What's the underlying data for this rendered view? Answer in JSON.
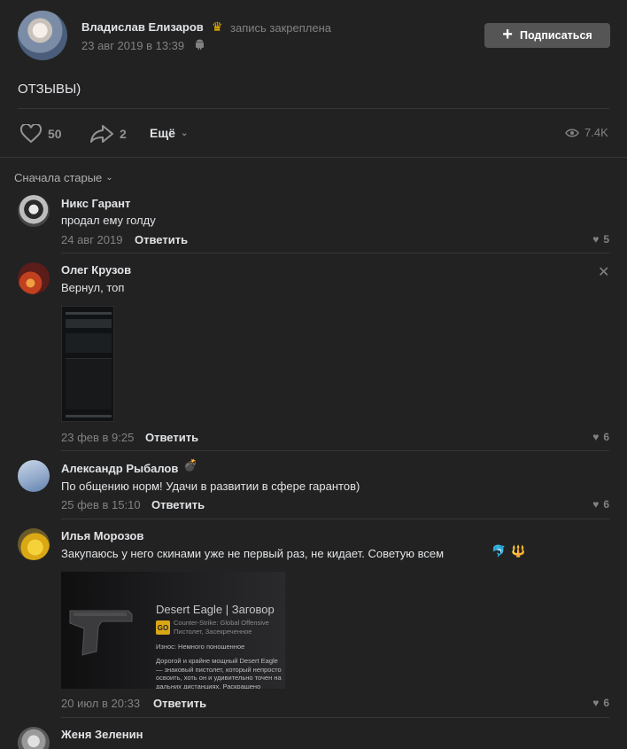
{
  "post": {
    "author": "Владислав Елизаров",
    "pinned_label": "запись закреплена",
    "date": "23 авг 2019 в 13:39",
    "subscribe_label": "Подписаться",
    "text": "ОТЗЫВЫ)",
    "likes": "50",
    "shares": "2",
    "more_label": "Ещё",
    "views": "7.4K"
  },
  "sort_label": "Сначала старые",
  "comments": [
    {
      "name": "Никс Гарант",
      "text": "продал ему голду",
      "date": "24 авг 2019",
      "reply": "Ответить",
      "likes": "5"
    },
    {
      "name": "Олег Крузов",
      "text": "Вернул, топ",
      "date": "23 фев в 9:25",
      "reply": "Ответить",
      "likes": "6"
    },
    {
      "name": "Александр Рыбалов",
      "text": "По общению норм! Удачи в развитии в сфере гарантов)",
      "date": "25 фев в 15:10",
      "reply": "Ответить",
      "likes": "6"
    },
    {
      "name": "Илья Морозов",
      "text": "Закупаюсь у него скинами уже не первый раз, не кидает. Советую всем",
      "date": "20 июл в 20:33",
      "reply": "Ответить",
      "likes": "6"
    },
    {
      "name": "Женя Зеленин"
    }
  ],
  "screenshot_card": {
    "title": "Desert Eagle | Заговор",
    "game": "Counter-Strike: Global Offensive",
    "type": "Пистолет, Засекреченное",
    "wear": "Износ: Немного поношенное",
    "desc": "Дорогой и крайне мощный Desert Eagle — знаковый пистолет, который непросто освоить, хоть он и удивительно точен на дальних дистанциях. Раскрашено"
  },
  "colors": {
    "background": "#222222",
    "text": "#e1e3e6",
    "muted": "#828282",
    "button": "#555555",
    "crown": "#f2b400"
  }
}
